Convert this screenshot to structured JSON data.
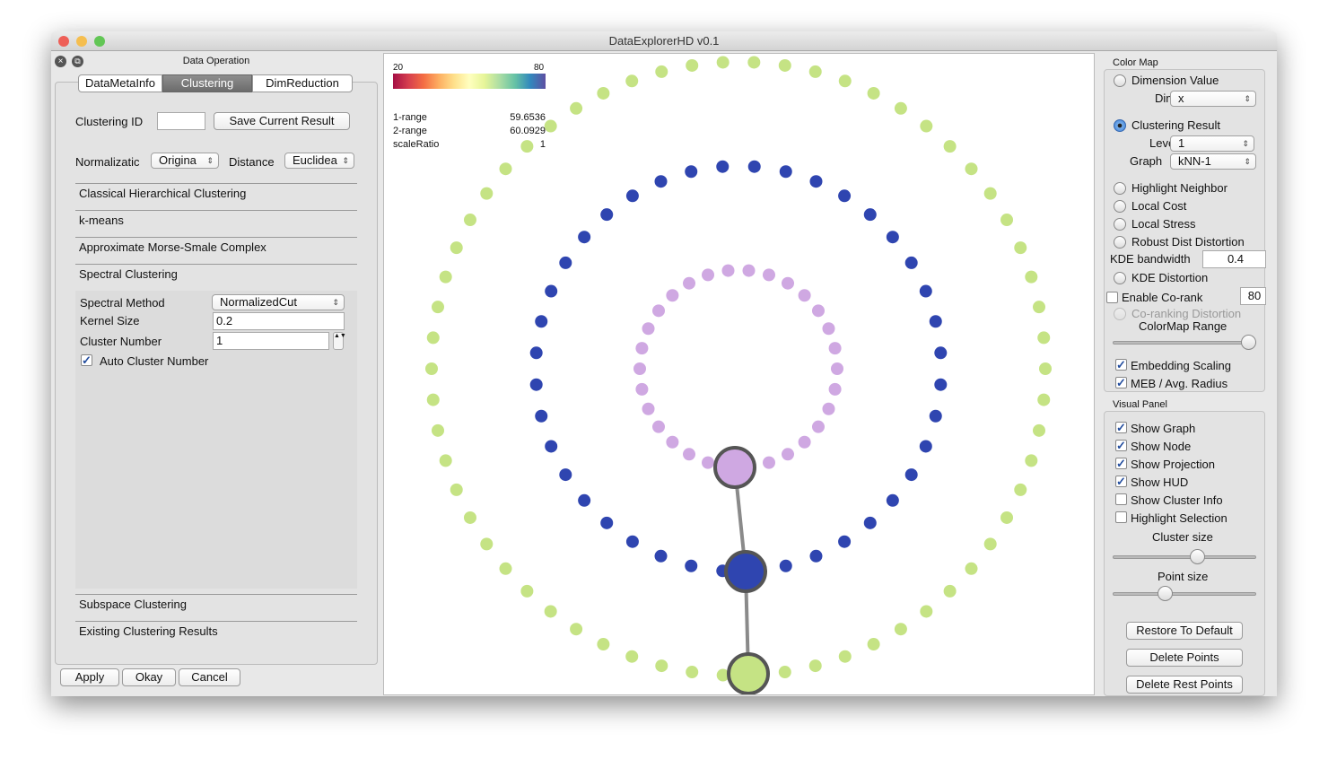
{
  "window": {
    "title": "DataExplorerHD v0.1"
  },
  "left": {
    "title": "Data Operation",
    "tabs": [
      "DataMetaInfo",
      "Clustering",
      "DimReduction"
    ],
    "active_tab": 1,
    "clustering_id_label": "Clustering ID",
    "clustering_id_value": "",
    "save_label": "Save Current Result",
    "normalization_label": "Normalizatic",
    "normalization_value": "Origina",
    "distance_label": "Distance",
    "distance_value": "Euclidea",
    "sections": [
      "Classical Hierarchical Clustering",
      "k-means",
      "Approximate Morse-Smale Complex",
      "Spectral Clustering"
    ],
    "spectral": {
      "method_label": "Spectral Method",
      "method_value": "NormalizedCut",
      "kernel_label": "Kernel Size",
      "kernel_value": "0.2",
      "cluster_label": "Cluster Number",
      "cluster_value": "1",
      "auto_label": "Auto Cluster Number",
      "auto_checked": true
    },
    "sections_bottom": [
      "Subspace Clustering",
      "Existing Clustering Results"
    ],
    "buttons": {
      "apply": "Apply",
      "okay": "Okay",
      "cancel": "Cancel"
    }
  },
  "hud": {
    "cmap_min": "20",
    "cmap_max": "80",
    "rows": [
      {
        "label": "1-range",
        "value": "59.6536"
      },
      {
        "label": "2-range",
        "value": "60.0929"
      },
      {
        "label": "scaleRatio",
        "value": "1"
      }
    ]
  },
  "plot": {
    "clusters": [
      {
        "color": "#c5e384",
        "count": 62
      },
      {
        "color": "#2f45b0",
        "count": 40
      },
      {
        "color": "#cfa8e2",
        "count": 30
      }
    ],
    "edge_color": "#8a8a8a"
  },
  "right": {
    "colormap_title": "Color Map",
    "dimension_value": "Dimension Value",
    "dim_label": "Dim",
    "dim_value": "x",
    "clustering_result": "Clustering Result",
    "level_label": "Level",
    "level_value": "1",
    "graph_label": "Graph",
    "graph_value": "kNN-1",
    "highlight_neighbor": "Highlight Neighbor",
    "local_cost": "Local Cost",
    "local_stress": "Local Stress",
    "robust": "Robust Dist Distortion",
    "kde_bw_label": "KDE bandwidth",
    "kde_bw_value": "0.4",
    "kde_distortion": "KDE Distortion",
    "corank_label": "Enable Co-rank",
    "corank_value": "80",
    "coranking_distortion": "Co-ranking Distortion",
    "cmap_range_label": "ColorMap Range",
    "cmap_range": 1.0,
    "embedding_scaling": "Embedding Scaling",
    "meb": "MEB / Avg. Radius",
    "visual_title": "Visual Panel",
    "show_graph": "Show Graph",
    "show_node": "Show Node",
    "show_projection": "Show Projection",
    "show_hud": "Show HUD",
    "show_cluster_info": "Show Cluster Info",
    "highlight_selection": "Highlight Selection",
    "cluster_size_label": "Cluster size",
    "cluster_size": 0.62,
    "point_size_label": "Point size",
    "point_size": 0.38,
    "restore": "Restore To Default",
    "delete_points": "Delete Points",
    "delete_rest": "Delete Rest Points"
  }
}
